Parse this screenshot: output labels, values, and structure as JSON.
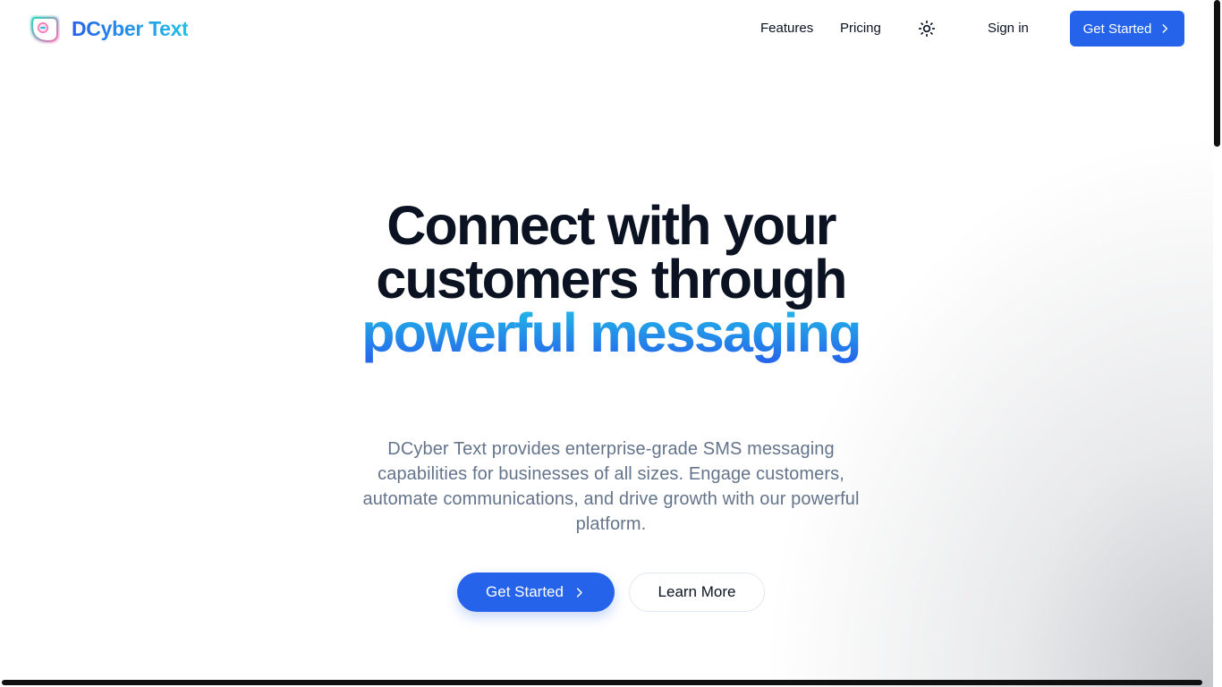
{
  "brand": {
    "name": "DCyber Text"
  },
  "nav": {
    "features": "Features",
    "pricing": "Pricing",
    "theme_icon": "sun-icon",
    "sign_in": "Sign in",
    "get_started": "Get Started"
  },
  "hero": {
    "headline_part1": "Connect with your customers through",
    "headline_accent": "powerful messaging",
    "description": "DCyber Text provides enterprise-grade SMS messaging capabilities for businesses of all sizes. Engage customers, automate communications, and drive growth with our powerful platform.",
    "primary_cta": "Get Started",
    "secondary_cta": "Learn More"
  },
  "colors": {
    "primary": "#2563eb",
    "accent_cyan": "#22c1e6",
    "text_dark": "#0b1222",
    "text_muted": "#64748b"
  }
}
